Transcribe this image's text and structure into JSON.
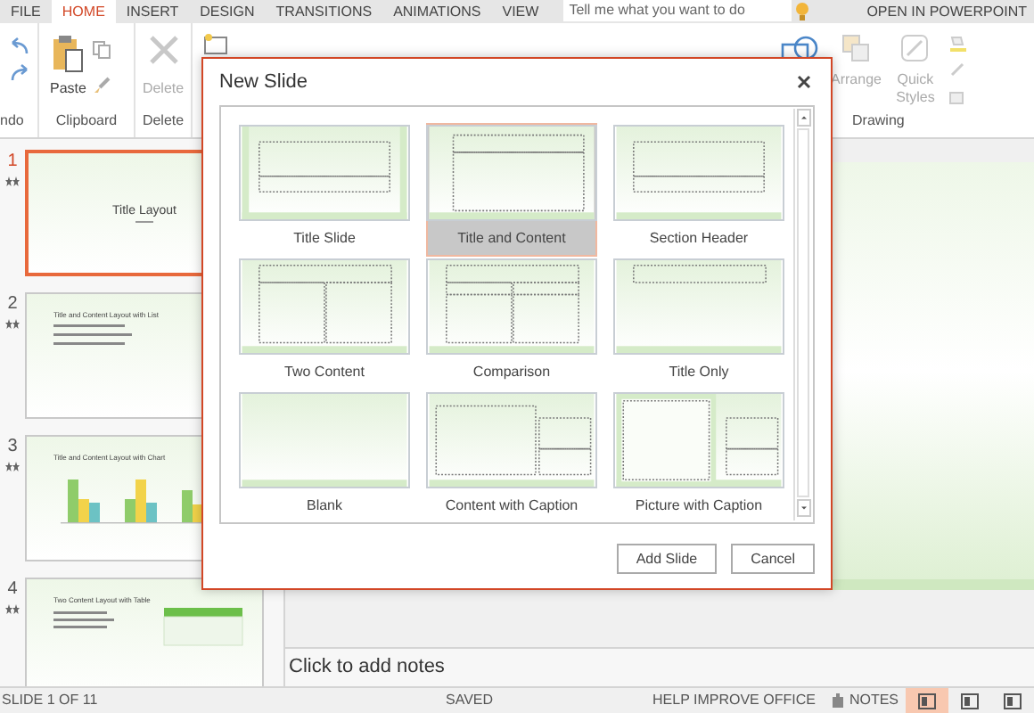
{
  "tabs": [
    {
      "label": "FILE",
      "selected": false
    },
    {
      "label": "HOME",
      "selected": true
    },
    {
      "label": "INSERT",
      "selected": false
    },
    {
      "label": "DESIGN",
      "selected": false
    },
    {
      "label": "TRANSITIONS",
      "selected": false
    },
    {
      "label": "ANIMATIONS",
      "selected": false
    },
    {
      "label": "VIEW",
      "selected": false
    }
  ],
  "search": {
    "placeholder": "Tell me what you want to do"
  },
  "open_button": "OPEN IN POWERPOINT",
  "ribbon": {
    "undo_group": "ndo",
    "paste": "Paste",
    "clipboard_group": "Clipboard",
    "delete_button": {
      "label": "Delete",
      "disabled": true
    },
    "delete_group": "Delete",
    "arrange": "Arrange",
    "quick_styles": "Quick Styles",
    "drawing_group": "Drawing"
  },
  "slides": [
    {
      "number": "1",
      "kind": "title",
      "title": "Title Layout",
      "selected": true
    },
    {
      "number": "2",
      "kind": "list",
      "title": "Title and Content Layout with List",
      "selected": false
    },
    {
      "number": "3",
      "kind": "chart",
      "title": "Title and Content Layout with Chart",
      "selected": false
    },
    {
      "number": "4",
      "kind": "table",
      "title": "Two Content Layout with Table",
      "selected": false
    }
  ],
  "dialog": {
    "title": "New Slide",
    "layouts": [
      {
        "label": "Title Slide",
        "kind": "title",
        "selected": false
      },
      {
        "label": "Title and Content",
        "kind": "title-content",
        "selected": true
      },
      {
        "label": "Section Header",
        "kind": "section",
        "selected": false
      },
      {
        "label": "Two Content",
        "kind": "two-content",
        "selected": false
      },
      {
        "label": "Comparison",
        "kind": "comparison",
        "selected": false
      },
      {
        "label": "Title Only",
        "kind": "title-only",
        "selected": false
      },
      {
        "label": "Blank",
        "kind": "blank",
        "selected": false
      },
      {
        "label": "Content with Caption",
        "kind": "content-caption",
        "selected": false
      },
      {
        "label": "Picture with Caption",
        "kind": "picture-caption",
        "selected": false
      }
    ],
    "buttons": [
      "Add Slide",
      "Cancel"
    ]
  },
  "notes": {
    "placeholder": "Click to add notes"
  },
  "status": {
    "slide_counter": "SLIDE 1 OF 11",
    "saved": "SAVED",
    "help": "HELP IMPROVE OFFICE",
    "notes": "NOTES",
    "views": [
      {
        "selected": true
      },
      {
        "selected": false
      },
      {
        "selected": false
      }
    ]
  }
}
